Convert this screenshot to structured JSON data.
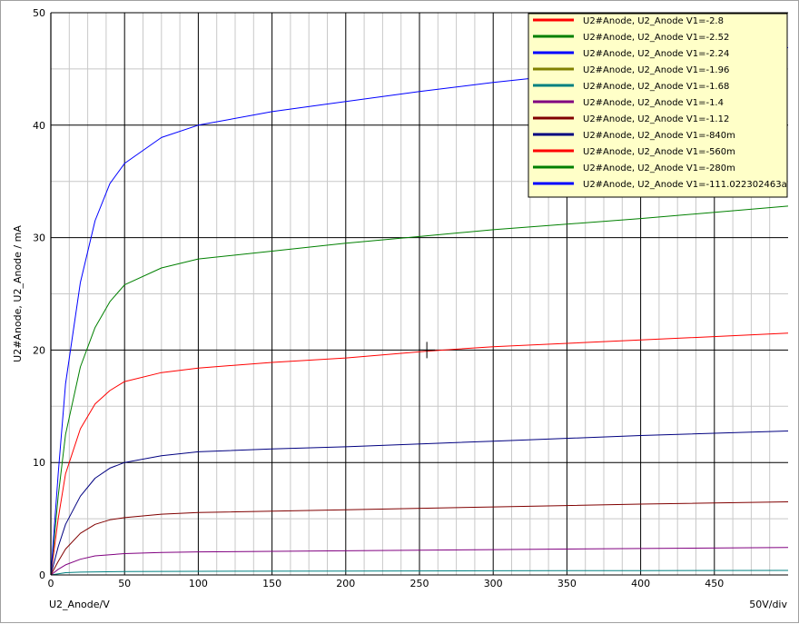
{
  "chart_data": {
    "type": "line",
    "title": "",
    "xlabel": "U2_Anode/V",
    "ylabel": "U2#Anode, U2_Anode / mA",
    "scale_label": "50V/div",
    "xlim": [
      0,
      500
    ],
    "ylim": [
      0,
      50
    ],
    "x_ticks": [
      0,
      50,
      100,
      150,
      200,
      250,
      300,
      350,
      400,
      450
    ],
    "y_ticks": [
      0,
      10,
      20,
      30,
      40,
      50
    ],
    "grid": "on",
    "legend_position": "top-right",
    "cursor": {
      "x": 255,
      "y": 20
    },
    "series": [
      {
        "name": "U2#Anode, U2_Anode V1=-2.8",
        "color": "#ff0000",
        "visible": false,
        "points": [
          [
            0,
            0
          ],
          [
            500,
            0
          ]
        ]
      },
      {
        "name": "U2#Anode, U2_Anode V1=-2.52",
        "color": "#008000",
        "visible": false,
        "points": [
          [
            0,
            0
          ],
          [
            500,
            0
          ]
        ]
      },
      {
        "name": "U2#Anode, U2_Anode V1=-2.24",
        "color": "#0000ff",
        "visible": false,
        "points": [
          [
            0,
            0
          ],
          [
            500,
            0
          ]
        ]
      },
      {
        "name": "U2#Anode, U2_Anode V1=-1.96",
        "color": "#808000",
        "visible": false,
        "points": [
          [
            0,
            0
          ],
          [
            500,
            0
          ]
        ]
      },
      {
        "name": "U2#Anode, U2_Anode V1=-1.68",
        "color": "#008080",
        "visible": true,
        "points": [
          [
            0,
            0
          ],
          [
            5,
            0.1
          ],
          [
            10,
            0.2
          ],
          [
            20,
            0.25
          ],
          [
            50,
            0.3
          ],
          [
            100,
            0.32
          ],
          [
            200,
            0.35
          ],
          [
            300,
            0.37
          ],
          [
            400,
            0.39
          ],
          [
            500,
            0.4
          ]
        ]
      },
      {
        "name": "U2#Anode, U2_Anode V1=-1.4",
        "color": "#800080",
        "visible": true,
        "points": [
          [
            0,
            0
          ],
          [
            5,
            0.5
          ],
          [
            10,
            0.9
          ],
          [
            20,
            1.4
          ],
          [
            30,
            1.7
          ],
          [
            50,
            1.9
          ],
          [
            75,
            2.0
          ],
          [
            100,
            2.05
          ],
          [
            200,
            2.15
          ],
          [
            300,
            2.25
          ],
          [
            400,
            2.35
          ],
          [
            500,
            2.45
          ]
        ]
      },
      {
        "name": "U2#Anode, U2_Anode V1=-1.12",
        "color": "#800000",
        "visible": true,
        "points": [
          [
            0,
            0
          ],
          [
            5,
            1.2
          ],
          [
            10,
            2.3
          ],
          [
            20,
            3.7
          ],
          [
            30,
            4.5
          ],
          [
            40,
            4.9
          ],
          [
            50,
            5.1
          ],
          [
            75,
            5.4
          ],
          [
            100,
            5.55
          ],
          [
            200,
            5.8
          ],
          [
            300,
            6.05
          ],
          [
            400,
            6.3
          ],
          [
            500,
            6.5
          ]
        ]
      },
      {
        "name": "U2#Anode, U2_Anode V1=-840m",
        "color": "#000080",
        "visible": true,
        "points": [
          [
            0,
            0
          ],
          [
            5,
            2.5
          ],
          [
            10,
            4.5
          ],
          [
            20,
            7.0
          ],
          [
            30,
            8.6
          ],
          [
            40,
            9.5
          ],
          [
            50,
            10.0
          ],
          [
            75,
            10.6
          ],
          [
            100,
            10.95
          ],
          [
            150,
            11.2
          ],
          [
            200,
            11.4
          ],
          [
            300,
            11.9
          ],
          [
            400,
            12.4
          ],
          [
            500,
            12.8
          ]
        ]
      },
      {
        "name": "U2#Anode, U2_Anode V1=-560m",
        "color": "#ff0000",
        "visible": true,
        "points": [
          [
            0,
            0
          ],
          [
            5,
            5
          ],
          [
            10,
            9
          ],
          [
            20,
            13
          ],
          [
            30,
            15.2
          ],
          [
            40,
            16.4
          ],
          [
            50,
            17.2
          ],
          [
            75,
            18.0
          ],
          [
            100,
            18.4
          ],
          [
            150,
            18.9
          ],
          [
            200,
            19.3
          ],
          [
            255,
            19.9
          ],
          [
            300,
            20.3
          ],
          [
            400,
            20.9
          ],
          [
            500,
            21.5
          ]
        ]
      },
      {
        "name": "U2#Anode, U2_Anode V1=-280m",
        "color": "#008000",
        "visible": true,
        "points": [
          [
            0,
            0
          ],
          [
            5,
            7
          ],
          [
            10,
            12.5
          ],
          [
            20,
            18.5
          ],
          [
            30,
            22.0
          ],
          [
            40,
            24.3
          ],
          [
            50,
            25.8
          ],
          [
            75,
            27.3
          ],
          [
            100,
            28.1
          ],
          [
            150,
            28.8
          ],
          [
            200,
            29.5
          ],
          [
            250,
            30.1
          ],
          [
            300,
            30.7
          ],
          [
            400,
            31.7
          ],
          [
            500,
            32.8
          ]
        ]
      },
      {
        "name": "U2#Anode, U2_Anode V1=-111.022302463a",
        "color": "#0000ff",
        "visible": true,
        "points": [
          [
            0,
            0
          ],
          [
            5,
            9
          ],
          [
            10,
            17
          ],
          [
            20,
            26
          ],
          [
            30,
            31.5
          ],
          [
            40,
            34.8
          ],
          [
            50,
            36.6
          ],
          [
            75,
            38.9
          ],
          [
            100,
            40.0
          ],
          [
            150,
            41.2
          ],
          [
            200,
            42.1
          ],
          [
            250,
            43.0
          ],
          [
            300,
            43.8
          ],
          [
            350,
            44.5
          ],
          [
            400,
            45.3
          ],
          [
            500,
            46.9
          ]
        ]
      }
    ]
  }
}
